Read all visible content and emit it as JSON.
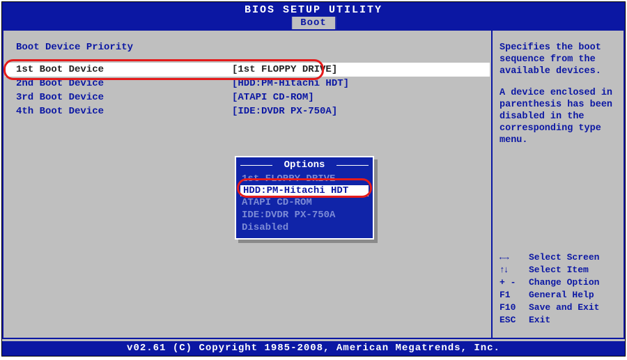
{
  "title": "BIOS SETUP UTILITY",
  "tab": "Boot",
  "section_title": "Boot Device Priority",
  "boot_devices": [
    {
      "label": "1st Boot Device",
      "value": "[1st FLOPPY DRIVE]",
      "selected": true
    },
    {
      "label": "2nd Boot Device",
      "value": "[HDD:PM-Hitachi HDT]",
      "selected": false
    },
    {
      "label": "3rd Boot Device",
      "value": "[ATAPI CD-ROM]",
      "selected": false
    },
    {
      "label": "4th Boot Device",
      "value": "[IDE:DVDR PX-750A]",
      "selected": false
    }
  ],
  "options": {
    "title": "Options",
    "items": [
      "1st FLOPPY DRIVE",
      "HDD:PM-Hitachi HDT",
      "ATAPI CD-ROM",
      "IDE:DVDR PX-750A",
      "Disabled"
    ],
    "selected_index": 1
  },
  "help": {
    "line1": "Specifies the boot sequence from the available devices.",
    "line2": "A device enclosed in parenthesis has been disabled in the corresponding type menu."
  },
  "keys": {
    "select_screen": "Select Screen",
    "select_item": "Select Item",
    "change_option_k": "+ -",
    "change_option": "Change Option",
    "f1": "F1",
    "general_help": "General Help",
    "f10": "F10",
    "save_exit": "Save and Exit",
    "esc": "ESC",
    "exit": "Exit"
  },
  "footer": "v02.61 (C) Copyright 1985-2008, American Megatrends, Inc."
}
